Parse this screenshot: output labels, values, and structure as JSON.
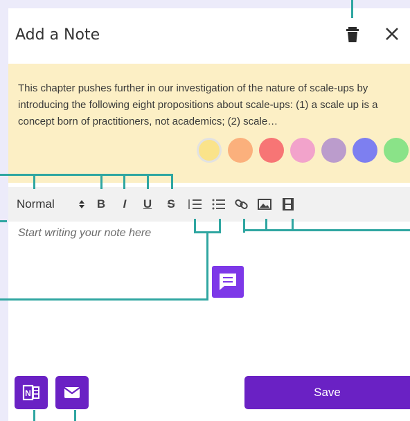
{
  "note_panel": {
    "title": "Add a Note",
    "highlight_text": "This chapter pushes further in our investigation of the nature of scale-ups by introducing the following eight propositions about scale-ups: (1) a scale up is a concept born of practitioners, not academics; (2) scale…"
  },
  "colors": {
    "accent": "#6a21c4",
    "annotation_line": "#2fa6a1",
    "highlight_bg": "#fcefc5",
    "swatches": [
      "#fae38a",
      "#fbb07c",
      "#f77575",
      "#f2a3cb",
      "#bb9ccc",
      "#7d7ff0",
      "#8ae388"
    ],
    "selected_swatch_index": 0
  },
  "toolbar": {
    "format_value": "Normal",
    "bold": "B",
    "italic": "I",
    "underline": "U",
    "strike": "S",
    "icons": [
      "ordered-list-icon",
      "bullet-list-icon",
      "link-icon",
      "image-icon",
      "video-icon"
    ]
  },
  "editor": {
    "placeholder": "Start writing your note here"
  },
  "footer": {
    "save_label": "Save",
    "left_buttons": [
      "onenote-icon",
      "email-icon"
    ]
  }
}
